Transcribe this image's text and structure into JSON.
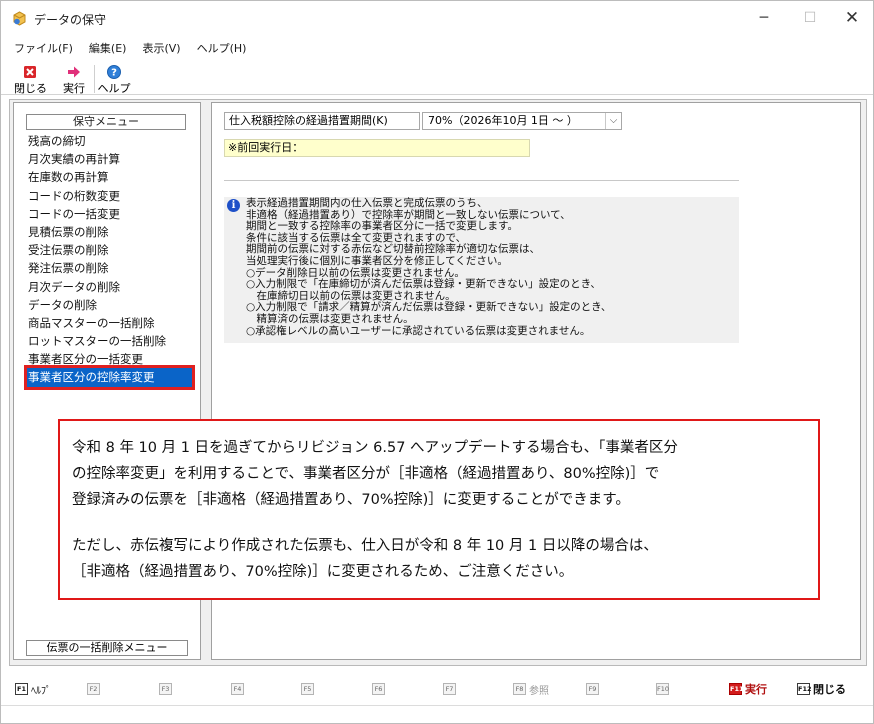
{
  "window": {
    "title": "データの保守",
    "minimize": "─",
    "maximize": "☐",
    "close": "✕"
  },
  "menu": [
    "ファイル(F)",
    "編集(E)",
    "表示(V)",
    "ヘルプ(H)"
  ],
  "toolbar": {
    "close_label": "閉じる",
    "exec_label": "実行",
    "help_label": "ヘルプ"
  },
  "sidebar": {
    "header": "保守メニュー",
    "items": [
      "残高の締切",
      "月次実績の再計算",
      "在庫数の再計算",
      "コードの桁数変更",
      "コードの一括変更",
      "見積伝票の削除",
      "受注伝票の削除",
      "発注伝票の削除",
      "月次データの削除",
      "データの削除",
      "商品マスターの一括削除",
      "ロットマスターの一括削除",
      "事業者区分の一括変更",
      "事業者区分の控除率変更"
    ],
    "selected_index": 13,
    "footer": "伝票の一括削除メニュー"
  },
  "form": {
    "period_label": "仕入税額控除の経過措置期間(K)",
    "period_value": "70%（2026年10月 1日 ～ ）",
    "last_exec": "※前回実行日："
  },
  "info_lines": [
    "表示経過措置期間内の仕入伝票と完成伝票のうち、",
    "非適格（経過措置あり）で控除率が期間と一致しない伝票について、",
    "期間と一致する控除率の事業者区分に一括で変更します。",
    "条件に該当する伝票は全て変更されますので、",
    "期間前の伝票に対する赤伝など切替前控除率が適切な伝票は、",
    "当処理実行後に個別に事業者区分を修正してください。",
    "○データ削除日以前の伝票は変更されません。",
    "○入力制限で「在庫締切が済んだ伝票は登録・更新できない」設定のとき、",
    "　在庫締切日以前の伝票は変更されません。",
    "○入力制限で「請求／精算が済んだ伝票は登録・更新できない」設定のとき、",
    "　精算済の伝票は変更されません。",
    "○承認権レベルの高いユーザーに承認されている伝票は変更されません。"
  ],
  "annotation": {
    "para1": [
      "令和 8 年 10 月 1 日を過ぎてからリビジョン 6.57 へアップデートする場合も、「事業者区分",
      "の控除率変更」を利用することで、事業者区分が［非適格（経過措置あり、80%控除)］で",
      "登録済みの伝票を［非適格（経過措置あり、70%控除)］に変更することができます。"
    ],
    "para2": [
      "ただし、赤伝複写により作成された伝票も、仕入日が令和 8 年 10 月 1 日以降の場合は、",
      "［非適格（経過措置あり、70%控除)］に変更されるため、ご注意ください。"
    ]
  },
  "fkeys": [
    {
      "key": "F1",
      "label": "ﾍﾙﾌﾟ"
    },
    {
      "key": "F2",
      "label": ""
    },
    {
      "key": "F3",
      "label": ""
    },
    {
      "key": "F4",
      "label": ""
    },
    {
      "key": "F5",
      "label": ""
    },
    {
      "key": "F6",
      "label": ""
    },
    {
      "key": "F7",
      "label": ""
    },
    {
      "key": "F8",
      "label": "参照"
    },
    {
      "key": "F9",
      "label": ""
    },
    {
      "key": "F10",
      "label": ""
    },
    {
      "key": "F11",
      "label": "実行"
    },
    {
      "key": "F12",
      "label": "閉じる"
    }
  ],
  "colors": {
    "selection": "#0a64c8",
    "highlight_border": "#e01818",
    "info_icon": "#1e50c8",
    "lastexec_bg": "#ffffcc"
  }
}
